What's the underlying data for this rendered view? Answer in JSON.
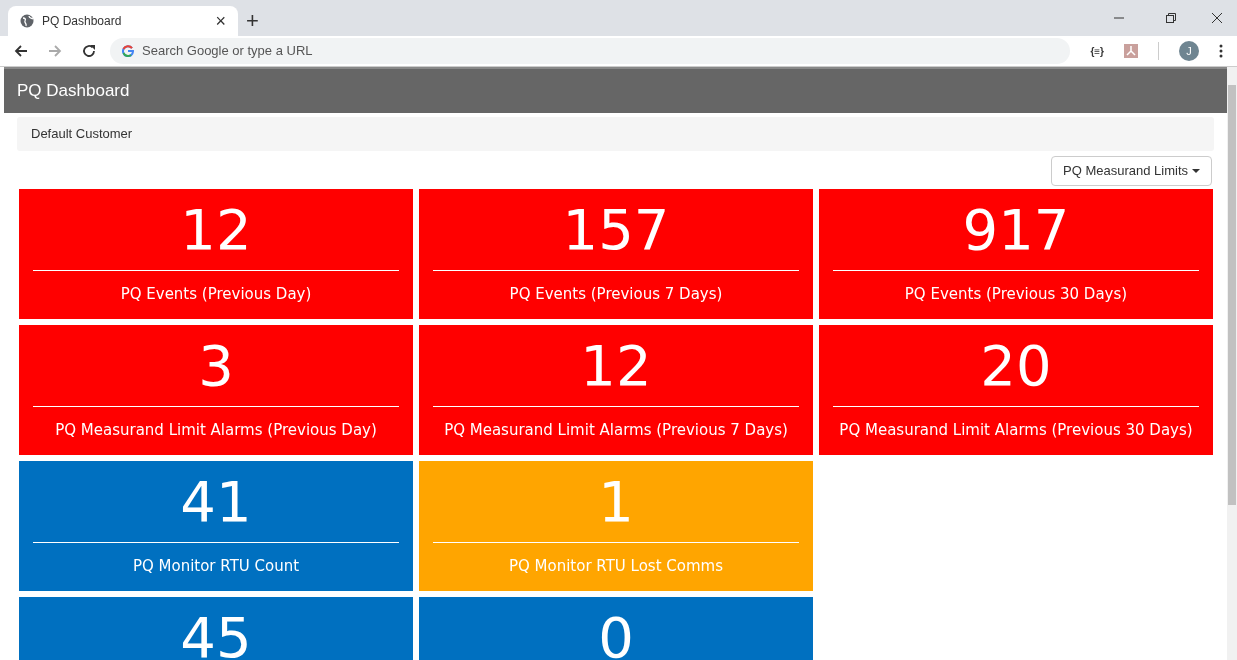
{
  "browser": {
    "tab_title": "PQ Dashboard",
    "new_tab": "+",
    "close_tab": "×",
    "address_placeholder": "Search Google or type a URL",
    "extension_label": "{≡}",
    "profile_initial": "J"
  },
  "header": {
    "title": "PQ Dashboard"
  },
  "breadcrumb": "Default Customer",
  "dropdown": {
    "label": "PQ Measurand Limits"
  },
  "tile_rows": [
    [
      {
        "value": "12",
        "label": "PQ Events (Previous Day)",
        "color": "#ff0000"
      },
      {
        "value": "157",
        "label": "PQ Events (Previous 7 Days)",
        "color": "#ff0000"
      },
      {
        "value": "917",
        "label": "PQ Events (Previous 30 Days)",
        "color": "#ff0000"
      }
    ],
    [
      {
        "value": "3",
        "label": "PQ Measurand Limit Alarms (Previous Day)",
        "color": "#ff0000"
      },
      {
        "value": "12",
        "label": "PQ Measurand Limit Alarms (Previous 7 Days)",
        "color": "#ff0000"
      },
      {
        "value": "20",
        "label": "PQ Measurand Limit Alarms (Previous 30 Days)",
        "color": "#ff0000"
      }
    ],
    [
      {
        "value": "41",
        "label": "PQ Monitor RTU Count",
        "color": "#0070c0"
      },
      {
        "value": "1",
        "label": "PQ Monitor RTU Lost Comms",
        "color": "#ffa500"
      }
    ],
    [
      {
        "value": "45",
        "color": "#0070c0"
      },
      {
        "value": "0",
        "color": "#0070c0"
      }
    ]
  ]
}
